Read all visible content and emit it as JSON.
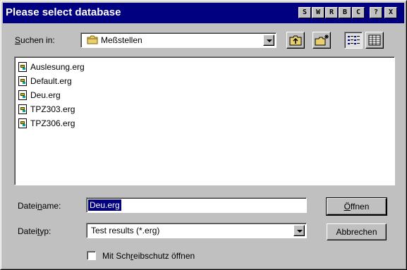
{
  "title": "Please select database",
  "title_buttons": [
    "S",
    "W",
    "R",
    "B",
    "C",
    "?",
    "X"
  ],
  "lookin": {
    "label": "Suchen in:",
    "value": "Meßstellen"
  },
  "files": [
    "Auslesung.erg",
    "Default.erg",
    "Deu.erg",
    "TPZ303.erg",
    "TPZ306.erg"
  ],
  "filename": {
    "label": "Dateiname:",
    "value": "Deu.erg"
  },
  "filetype": {
    "label": "Dateityp:",
    "value": "Test results (*.erg)"
  },
  "buttons": {
    "open": "Öffnen",
    "cancel": "Abbrechen"
  },
  "readonly_checkbox": {
    "label": "Mit Schreibschutz öffnen",
    "checked": false
  }
}
